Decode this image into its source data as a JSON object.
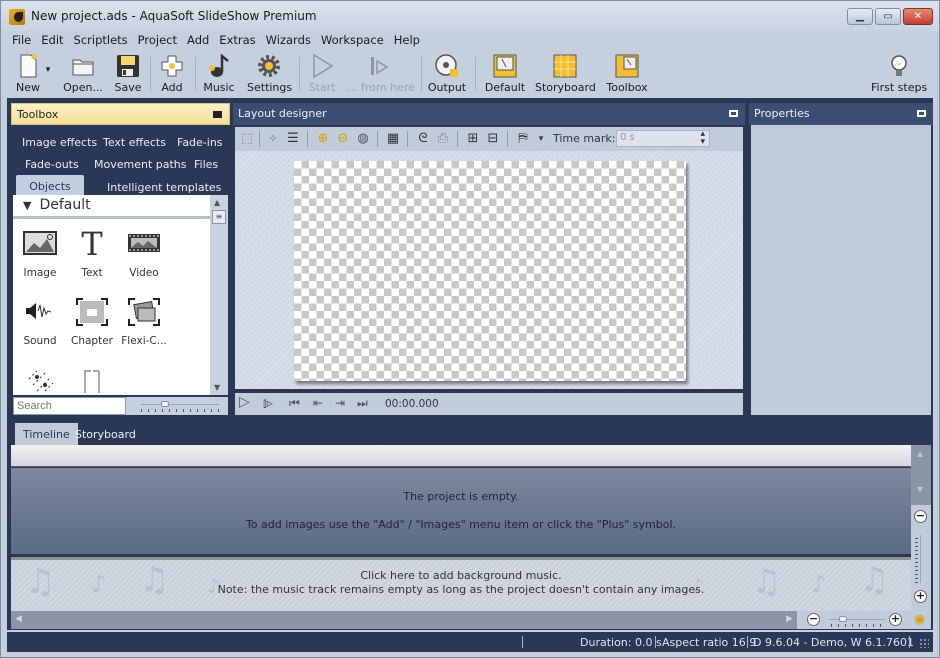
{
  "window": {
    "title": "New project.ads - AquaSoft SlideShow Premium",
    "controls": [
      "minimize",
      "maximize",
      "close"
    ]
  },
  "menubar": [
    "File",
    "Edit",
    "Scriptlets",
    "Project",
    "Add",
    "Extras",
    "Wizards",
    "Workspace",
    "Help"
  ],
  "toolbar": {
    "new": "New",
    "open": "Open...",
    "save": "Save",
    "add": "Add",
    "music": "Music",
    "settings": "Settings",
    "start": "Start",
    "from_here": "... from here",
    "output": "Output",
    "default": "Default",
    "storyboard": "Storyboard",
    "toolbox": "Toolbox",
    "first_steps": "First steps"
  },
  "toolbox": {
    "title": "Toolbox",
    "tabs": [
      "Image effects",
      "Text effects",
      "Fade-ins",
      "Fade-outs",
      "Movement paths",
      "Files",
      "Objects",
      "Intelligent templates"
    ],
    "active_tab": "Objects",
    "group": "Default",
    "items": [
      "Image",
      "Text",
      "Video",
      "Sound",
      "Chapter",
      "Flexi-C..."
    ],
    "search_placeholder": "Search"
  },
  "designer": {
    "title": "Layout designer",
    "time_mark_label": "Time mark:",
    "time_mark_value": "0 s",
    "playback_time": "00:00.000"
  },
  "properties": {
    "title": "Properties"
  },
  "bottom_tabs": [
    "Timeline",
    "Storyboard"
  ],
  "timeline": {
    "empty_title": "The project is empty.",
    "empty_hint": "To add images use the \"Add\" / \"Images\" menu item or click the \"Plus\" symbol.",
    "music_hint": "Click here to add background music.",
    "music_note": "Note: the music track remains empty as long as the project doesn't contain any images."
  },
  "statusbar": {
    "duration": "Duration: 0.0 s",
    "aspect": "Aspect ratio 16:9",
    "version": "D 9.6.04 - Demo, W 6.1.7601"
  },
  "colors": {
    "workspace": "#2a3856",
    "panel_header": "#3b4d70",
    "toolbox_header": "#f7df98",
    "panel_body": "#c1ccdb"
  }
}
